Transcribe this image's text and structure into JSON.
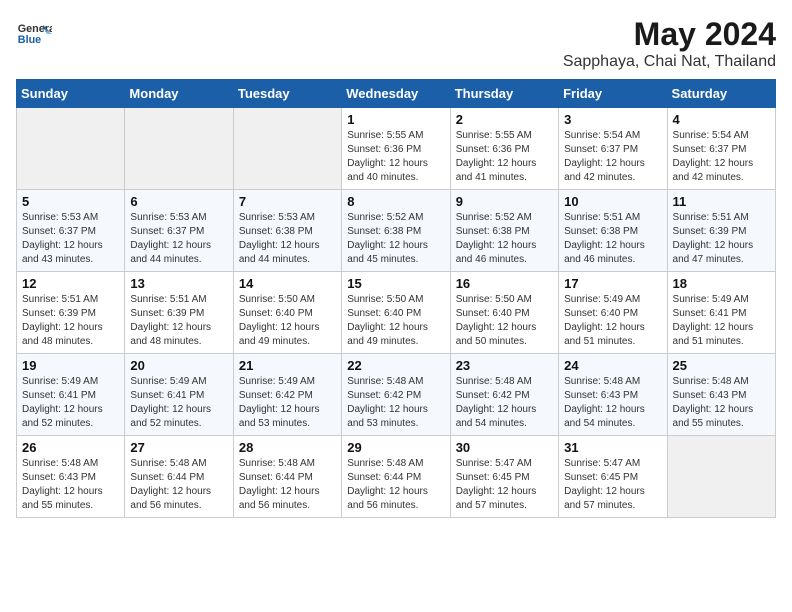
{
  "app": {
    "name_general": "General",
    "name_blue": "Blue"
  },
  "title": "May 2024",
  "subtitle": "Sapphaya, Chai Nat, Thailand",
  "weekdays": [
    "Sunday",
    "Monday",
    "Tuesday",
    "Wednesday",
    "Thursday",
    "Friday",
    "Saturday"
  ],
  "weeks": [
    [
      {
        "day": "",
        "sunrise": "",
        "sunset": "",
        "daylight": "",
        "empty": true
      },
      {
        "day": "",
        "sunrise": "",
        "sunset": "",
        "daylight": "",
        "empty": true
      },
      {
        "day": "",
        "sunrise": "",
        "sunset": "",
        "daylight": "",
        "empty": true
      },
      {
        "day": "1",
        "sunrise": "Sunrise: 5:55 AM",
        "sunset": "Sunset: 6:36 PM",
        "daylight": "Daylight: 12 hours and 40 minutes."
      },
      {
        "day": "2",
        "sunrise": "Sunrise: 5:55 AM",
        "sunset": "Sunset: 6:36 PM",
        "daylight": "Daylight: 12 hours and 41 minutes."
      },
      {
        "day": "3",
        "sunrise": "Sunrise: 5:54 AM",
        "sunset": "Sunset: 6:37 PM",
        "daylight": "Daylight: 12 hours and 42 minutes."
      },
      {
        "day": "4",
        "sunrise": "Sunrise: 5:54 AM",
        "sunset": "Sunset: 6:37 PM",
        "daylight": "Daylight: 12 hours and 42 minutes."
      }
    ],
    [
      {
        "day": "5",
        "sunrise": "Sunrise: 5:53 AM",
        "sunset": "Sunset: 6:37 PM",
        "daylight": "Daylight: 12 hours and 43 minutes."
      },
      {
        "day": "6",
        "sunrise": "Sunrise: 5:53 AM",
        "sunset": "Sunset: 6:37 PM",
        "daylight": "Daylight: 12 hours and 44 minutes."
      },
      {
        "day": "7",
        "sunrise": "Sunrise: 5:53 AM",
        "sunset": "Sunset: 6:38 PM",
        "daylight": "Daylight: 12 hours and 44 minutes."
      },
      {
        "day": "8",
        "sunrise": "Sunrise: 5:52 AM",
        "sunset": "Sunset: 6:38 PM",
        "daylight": "Daylight: 12 hours and 45 minutes."
      },
      {
        "day": "9",
        "sunrise": "Sunrise: 5:52 AM",
        "sunset": "Sunset: 6:38 PM",
        "daylight": "Daylight: 12 hours and 46 minutes."
      },
      {
        "day": "10",
        "sunrise": "Sunrise: 5:51 AM",
        "sunset": "Sunset: 6:38 PM",
        "daylight": "Daylight: 12 hours and 46 minutes."
      },
      {
        "day": "11",
        "sunrise": "Sunrise: 5:51 AM",
        "sunset": "Sunset: 6:39 PM",
        "daylight": "Daylight: 12 hours and 47 minutes."
      }
    ],
    [
      {
        "day": "12",
        "sunrise": "Sunrise: 5:51 AM",
        "sunset": "Sunset: 6:39 PM",
        "daylight": "Daylight: 12 hours and 48 minutes."
      },
      {
        "day": "13",
        "sunrise": "Sunrise: 5:51 AM",
        "sunset": "Sunset: 6:39 PM",
        "daylight": "Daylight: 12 hours and 48 minutes."
      },
      {
        "day": "14",
        "sunrise": "Sunrise: 5:50 AM",
        "sunset": "Sunset: 6:40 PM",
        "daylight": "Daylight: 12 hours and 49 minutes."
      },
      {
        "day": "15",
        "sunrise": "Sunrise: 5:50 AM",
        "sunset": "Sunset: 6:40 PM",
        "daylight": "Daylight: 12 hours and 49 minutes."
      },
      {
        "day": "16",
        "sunrise": "Sunrise: 5:50 AM",
        "sunset": "Sunset: 6:40 PM",
        "daylight": "Daylight: 12 hours and 50 minutes."
      },
      {
        "day": "17",
        "sunrise": "Sunrise: 5:49 AM",
        "sunset": "Sunset: 6:40 PM",
        "daylight": "Daylight: 12 hours and 51 minutes."
      },
      {
        "day": "18",
        "sunrise": "Sunrise: 5:49 AM",
        "sunset": "Sunset: 6:41 PM",
        "daylight": "Daylight: 12 hours and 51 minutes."
      }
    ],
    [
      {
        "day": "19",
        "sunrise": "Sunrise: 5:49 AM",
        "sunset": "Sunset: 6:41 PM",
        "daylight": "Daylight: 12 hours and 52 minutes."
      },
      {
        "day": "20",
        "sunrise": "Sunrise: 5:49 AM",
        "sunset": "Sunset: 6:41 PM",
        "daylight": "Daylight: 12 hours and 52 minutes."
      },
      {
        "day": "21",
        "sunrise": "Sunrise: 5:49 AM",
        "sunset": "Sunset: 6:42 PM",
        "daylight": "Daylight: 12 hours and 53 minutes."
      },
      {
        "day": "22",
        "sunrise": "Sunrise: 5:48 AM",
        "sunset": "Sunset: 6:42 PM",
        "daylight": "Daylight: 12 hours and 53 minutes."
      },
      {
        "day": "23",
        "sunrise": "Sunrise: 5:48 AM",
        "sunset": "Sunset: 6:42 PM",
        "daylight": "Daylight: 12 hours and 54 minutes."
      },
      {
        "day": "24",
        "sunrise": "Sunrise: 5:48 AM",
        "sunset": "Sunset: 6:43 PM",
        "daylight": "Daylight: 12 hours and 54 minutes."
      },
      {
        "day": "25",
        "sunrise": "Sunrise: 5:48 AM",
        "sunset": "Sunset: 6:43 PM",
        "daylight": "Daylight: 12 hours and 55 minutes."
      }
    ],
    [
      {
        "day": "26",
        "sunrise": "Sunrise: 5:48 AM",
        "sunset": "Sunset: 6:43 PM",
        "daylight": "Daylight: 12 hours and 55 minutes."
      },
      {
        "day": "27",
        "sunrise": "Sunrise: 5:48 AM",
        "sunset": "Sunset: 6:44 PM",
        "daylight": "Daylight: 12 hours and 56 minutes."
      },
      {
        "day": "28",
        "sunrise": "Sunrise: 5:48 AM",
        "sunset": "Sunset: 6:44 PM",
        "daylight": "Daylight: 12 hours and 56 minutes."
      },
      {
        "day": "29",
        "sunrise": "Sunrise: 5:48 AM",
        "sunset": "Sunset: 6:44 PM",
        "daylight": "Daylight: 12 hours and 56 minutes."
      },
      {
        "day": "30",
        "sunrise": "Sunrise: 5:47 AM",
        "sunset": "Sunset: 6:45 PM",
        "daylight": "Daylight: 12 hours and 57 minutes."
      },
      {
        "day": "31",
        "sunrise": "Sunrise: 5:47 AM",
        "sunset": "Sunset: 6:45 PM",
        "daylight": "Daylight: 12 hours and 57 minutes."
      },
      {
        "day": "",
        "sunrise": "",
        "sunset": "",
        "daylight": "",
        "empty": true
      }
    ]
  ]
}
